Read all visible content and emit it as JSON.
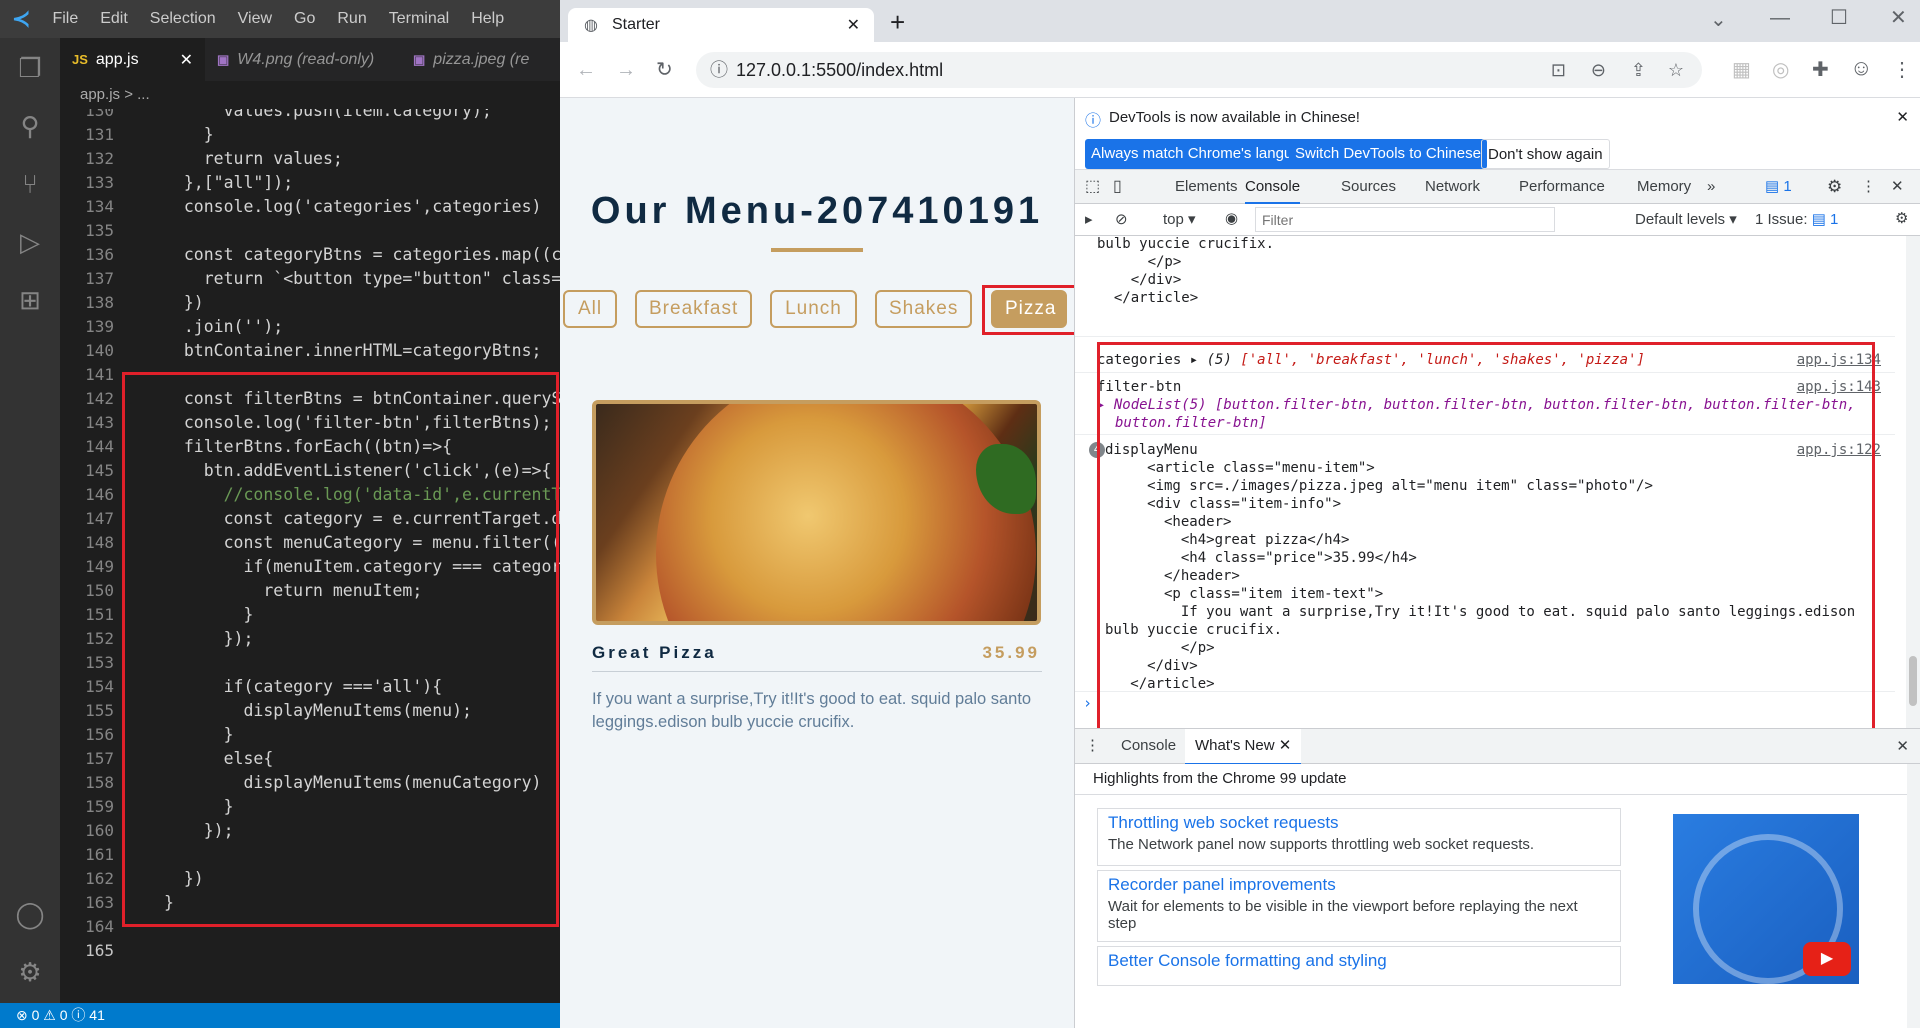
{
  "vscode": {
    "menu": [
      "File",
      "Edit",
      "Selection",
      "View",
      "Go",
      "Run",
      "Terminal",
      "Help"
    ],
    "tabs": [
      {
        "label": "app.js",
        "icon": "JS",
        "active": true
      },
      {
        "label": "W4.png (read-only)",
        "icon": "img",
        "active": false
      },
      {
        "label": "pizza.jpeg (re",
        "icon": "img",
        "active": false
      }
    ],
    "breadcrumb": "app.js > ...",
    "status": "⊗ 0  ⚠ 0  ⓘ 41",
    "lines": [
      {
        "n": "130",
        "t": "      values.push(item.category);"
      },
      {
        "n": "131",
        "t": "    }"
      },
      {
        "n": "132",
        "t": "    return values;"
      },
      {
        "n": "133",
        "t": "  },[\"all\"]);"
      },
      {
        "n": "134",
        "t": "  console.log('categories',categories)"
      },
      {
        "n": "135",
        "t": ""
      },
      {
        "n": "136",
        "t": "  const categoryBtns = categories.map((cate"
      },
      {
        "n": "137",
        "t": "    return `<button type=\"button\" class=\"fi"
      },
      {
        "n": "138",
        "t": "  })"
      },
      {
        "n": "139",
        "t": "  .join('');"
      },
      {
        "n": "140",
        "t": "  btnContainer.innerHTML=categoryBtns;"
      },
      {
        "n": "141",
        "t": ""
      },
      {
        "n": "142",
        "t": "  const filterBtns = btnContainer.querySele"
      },
      {
        "n": "143",
        "t": "  console.log('filter-btn',filterBtns);"
      },
      {
        "n": "144",
        "t": "  filterBtns.forEach((btn)=>{"
      },
      {
        "n": "145",
        "t": "    btn.addEventListener('click',(e)=>{"
      },
      {
        "n": "146",
        "t": "      //console.log('data-id',e.currentTarg"
      },
      {
        "n": "147",
        "t": "      const category = e.currentTarget.data"
      },
      {
        "n": "148",
        "t": "      const menuCategory = menu.filter((men"
      },
      {
        "n": "149",
        "t": "        if(menuItem.category === category){"
      },
      {
        "n": "150",
        "t": "          return menuItem;"
      },
      {
        "n": "151",
        "t": "        }"
      },
      {
        "n": "152",
        "t": "      });"
      },
      {
        "n": "153",
        "t": ""
      },
      {
        "n": "154",
        "t": "      if(category ==='all'){"
      },
      {
        "n": "155",
        "t": "        displayMenuItems(menu);"
      },
      {
        "n": "156",
        "t": "      }"
      },
      {
        "n": "157",
        "t": "      else{"
      },
      {
        "n": "158",
        "t": "        displayMenuItems(menuCategory)"
      },
      {
        "n": "159",
        "t": "      }"
      },
      {
        "n": "160",
        "t": "    });"
      },
      {
        "n": "161",
        "t": ""
      },
      {
        "n": "162",
        "t": "  })"
      },
      {
        "n": "163",
        "t": "}"
      },
      {
        "n": "164",
        "t": ""
      },
      {
        "n": "165",
        "t": ""
      }
    ]
  },
  "chrome": {
    "tab_title": "Starter",
    "url": "127.0.0.1:5500/index.html"
  },
  "page": {
    "title": "Our Menu-207410191",
    "categories": [
      "All",
      "Breakfast",
      "Lunch",
      "Shakes",
      "Pizza"
    ],
    "selected_category": "Pizza",
    "item": {
      "name": "Great Pizza",
      "price": "35.99",
      "text": "If you want a surprise,Try it!It's good to eat. squid palo santo leggings.edison bulb yuccie crucifix."
    }
  },
  "devtools": {
    "banner": "DevTools is now available in Chinese!",
    "banner_buttons": [
      "Always match Chrome's language",
      "Switch DevTools to Chinese",
      "Don't show again"
    ],
    "tabs": [
      "Elements",
      "Console",
      "Sources",
      "Network",
      "Performance",
      "Memory"
    ],
    "active_tab": "Console",
    "issues_badge": "1",
    "context": "top",
    "filter_placeholder": "Filter",
    "levels": "Default levels",
    "issue_count": "1 Issue:",
    "issue_num": "1",
    "console_top": [
      "bulb yuccie crucifix.",
      "      </p>",
      "    </div>",
      "  </article>"
    ],
    "logs": {
      "categories": {
        "label": "categories",
        "count": "(5)",
        "values": "['all', 'breakfast', 'lunch', 'shakes', 'pizza']",
        "src": "app.js:134"
      },
      "filter": {
        "label": "filter-btn",
        "line1": "NodeList(5) [button.filter-btn, button.filter-btn, button.filter-btn, button.filter-btn,",
        "line2": "button.filter-btn]",
        "src": "app.js:143"
      },
      "display": {
        "label": "displayMenu",
        "src": "app.js:122",
        "badge": "4",
        "lines": [
          "     <article class=\"menu-item\">",
          "     <img src=./images/pizza.jpeg alt=\"menu item\" class=\"photo\"/>",
          "     <div class=\"item-info\">",
          "       <header>",
          "         <h4>great pizza</h4>",
          "         <h4 class=\"price\">35.99</h4>",
          "       </header>",
          "       <p class=\"item item-text\">",
          "         If you want a surprise,Try it!It's good to eat. squid palo santo leggings.edison",
          "bulb yuccie crucifix.",
          "         </p>",
          "     </div>",
          "   </article>"
        ]
      }
    },
    "drawer_tabs": [
      "Console",
      "What's New"
    ],
    "whats_new": {
      "heading": "Highlights from the Chrome 99 update",
      "cards": [
        {
          "title": "Throttling web socket requests",
          "desc": "The Network panel now supports throttling web socket requests."
        },
        {
          "title": "Recorder panel improvements",
          "desc": "Wait for elements to be visible in the viewport before replaying the next step"
        },
        {
          "title": "Better Console formatting and styling",
          "desc": ""
        }
      ]
    }
  }
}
